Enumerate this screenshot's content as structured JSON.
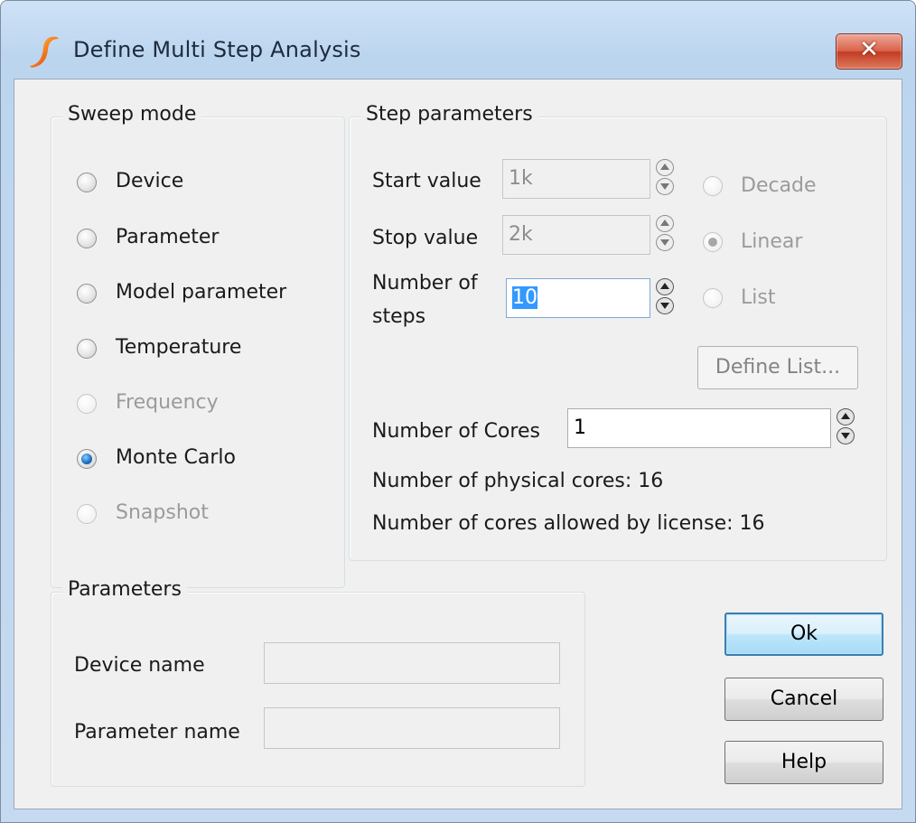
{
  "window": {
    "title": "Define Multi Step Analysis",
    "close_label": "✕"
  },
  "sweep_mode": {
    "legend": "Sweep mode",
    "options": [
      {
        "label": "Device",
        "state": "enabled"
      },
      {
        "label": "Parameter",
        "state": "enabled"
      },
      {
        "label": "Model parameter",
        "state": "enabled"
      },
      {
        "label": "Temperature",
        "state": "enabled"
      },
      {
        "label": "Frequency",
        "state": "disabled"
      },
      {
        "label": "Monte Carlo",
        "state": "selected"
      },
      {
        "label": "Snapshot",
        "state": "disabled"
      }
    ]
  },
  "step_parameters": {
    "legend": "Step parameters",
    "start_value_label": "Start value",
    "start_value": "1k",
    "stop_value_label": "Stop value",
    "stop_value": "2k",
    "num_steps_label_line1": "Number of",
    "num_steps_label_line2": "steps",
    "num_steps_value": "10",
    "scale_options": [
      {
        "label": "Decade",
        "state": "disabled"
      },
      {
        "label": "Linear",
        "state": "selected-disabled"
      },
      {
        "label": "List",
        "state": "disabled"
      }
    ],
    "define_list_label": "Define List...",
    "num_cores_label": "Number of Cores",
    "num_cores_value": "1",
    "physical_cores_text": "Number of physical cores: 16",
    "license_cores_text": "Number of cores allowed by license: 16"
  },
  "parameters": {
    "legend": "Parameters",
    "device_name_label": "Device name",
    "device_name_value": "",
    "parameter_name_label": "Parameter name",
    "parameter_name_value": ""
  },
  "buttons": {
    "ok": "Ok",
    "cancel": "Cancel",
    "help": "Help"
  },
  "colors": {
    "title_bar": "#c5daf1",
    "close_button": "#d9634b",
    "dialog_bg": "#f0f0f0",
    "selection": "#3399ff",
    "default_button_border": "#3c7fb1"
  },
  "icons": {
    "app": "simetrix-s-icon",
    "close": "close-x-icon",
    "spin": "spin-up-down-icon"
  }
}
